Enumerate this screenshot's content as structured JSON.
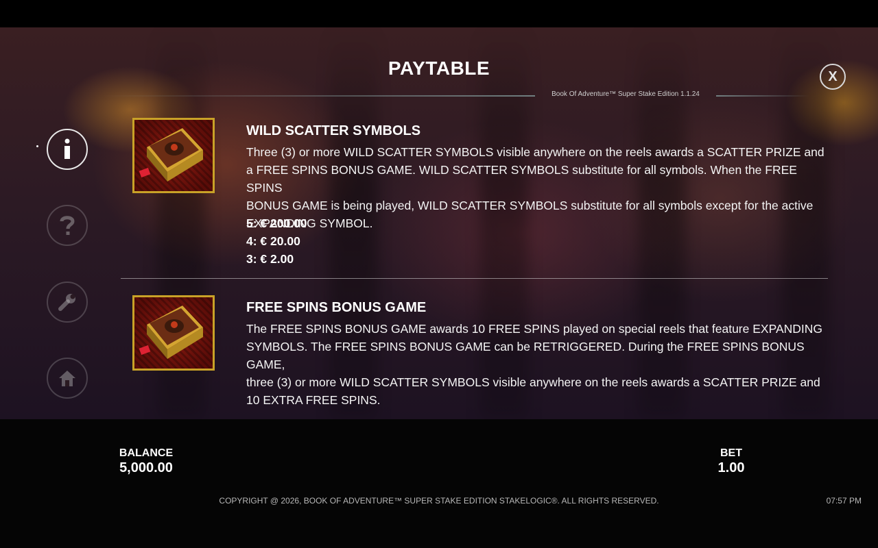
{
  "header": {
    "title": "PAYTABLE",
    "version": "Book Of Adventure™ Super Stake Edition 1.1.24",
    "close_label": "X"
  },
  "nav": {
    "items": [
      {
        "id": "info",
        "icon": "info-icon",
        "active": true
      },
      {
        "id": "help",
        "icon": "question-icon",
        "active": false
      },
      {
        "id": "settings",
        "icon": "wrench-icon",
        "active": false
      },
      {
        "id": "home",
        "icon": "home-icon",
        "active": false
      }
    ]
  },
  "sections": [
    {
      "symbol_icon": "book-wild-scatter-symbol",
      "heading": "WILD SCATTER SYMBOLS",
      "lines": [
        "Three (3) or more WILD SCATTER SYMBOLS visible anywhere on the reels awards a SCATTER PRIZE and",
        "a FREE SPINS BONUS GAME. WILD SCATTER SYMBOLS substitute for all symbols. When the FREE SPINS",
        "BONUS GAME is being played, WILD SCATTER SYMBOLS substitute for all symbols except for the active",
        "EXPANDING SYMBOL."
      ],
      "pays": [
        "5: € 200.00",
        "4: € 20.00",
        "3: € 2.00"
      ]
    },
    {
      "symbol_icon": "book-wild-scatter-symbol",
      "heading": "FREE SPINS BONUS GAME",
      "lines": [
        "The FREE SPINS BONUS GAME awards 10 FREE SPINS played on special reels that feature EXPANDING",
        "SYMBOLS. The FREE SPINS BONUS GAME can be RETRIGGERED. During the FREE SPINS BONUS GAME,",
        "three (3) or more WILD SCATTER SYMBOLS visible anywhere on the reels awards a SCATTER PRIZE and",
        "10 EXTRA FREE SPINS."
      ]
    }
  ],
  "footer": {
    "balance_label": "BALANCE",
    "balance_value": "5,000.00",
    "bet_label": "BET",
    "bet_value": "1.00",
    "copyright": "COPYRIGHT @ 2026, BOOK OF ADVENTURE™ SUPER STAKE EDITION STAKELOGIC®. ALL RIGHTS RESERVED.",
    "time": "07:57 PM"
  },
  "colors": {
    "gold": "#c9a227",
    "text": "#ffffff"
  }
}
